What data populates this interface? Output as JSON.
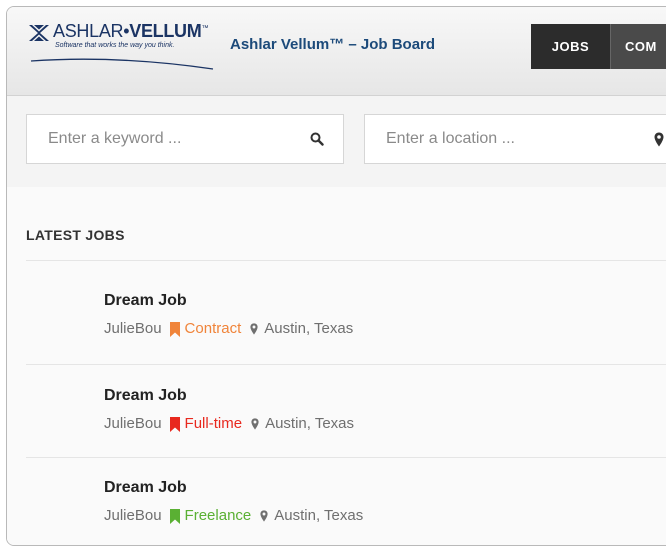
{
  "brand": {
    "logo_name_light": "ASHLAR",
    "logo_dot": "•",
    "logo_name_bold": "VELLUM",
    "logo_tm": "™",
    "logo_tagline": "Software that works the way you think.",
    "app_title": "Ashlar Vellum™ – Job Board"
  },
  "nav": {
    "items": [
      {
        "label": "JOBS",
        "active": true
      },
      {
        "label": "COM",
        "active": false
      }
    ]
  },
  "search": {
    "keyword_placeholder": "Enter a keyword ...",
    "keyword_value": "",
    "location_placeholder": "Enter a location ...",
    "location_value": ""
  },
  "latest": {
    "heading": "LATEST JOBS",
    "jobs": [
      {
        "title": "Dream Job",
        "company": "JulieBou",
        "type": "Contract",
        "type_color": "#f0843a",
        "location": "Austin, Texas"
      },
      {
        "title": "Dream Job",
        "company": "JulieBou",
        "type": "Full-time",
        "type_color": "#e8281e",
        "location": "Austin, Texas"
      },
      {
        "title": "Dream Job",
        "company": "JulieBou",
        "type": "Freelance",
        "type_color": "#5ab033",
        "location": "Austin, Texas"
      }
    ]
  },
  "icons": {
    "keyword_search": "search-icon",
    "location_search": "location-pin-icon",
    "job_type": "bookmark-icon",
    "job_location": "location-pin-icon"
  },
  "colors": {
    "brand_navy": "#1b3464",
    "title_blue": "#1c4a7a",
    "nav_active": "#2c2c2c",
    "nav_inactive": "#4a4a4a"
  }
}
